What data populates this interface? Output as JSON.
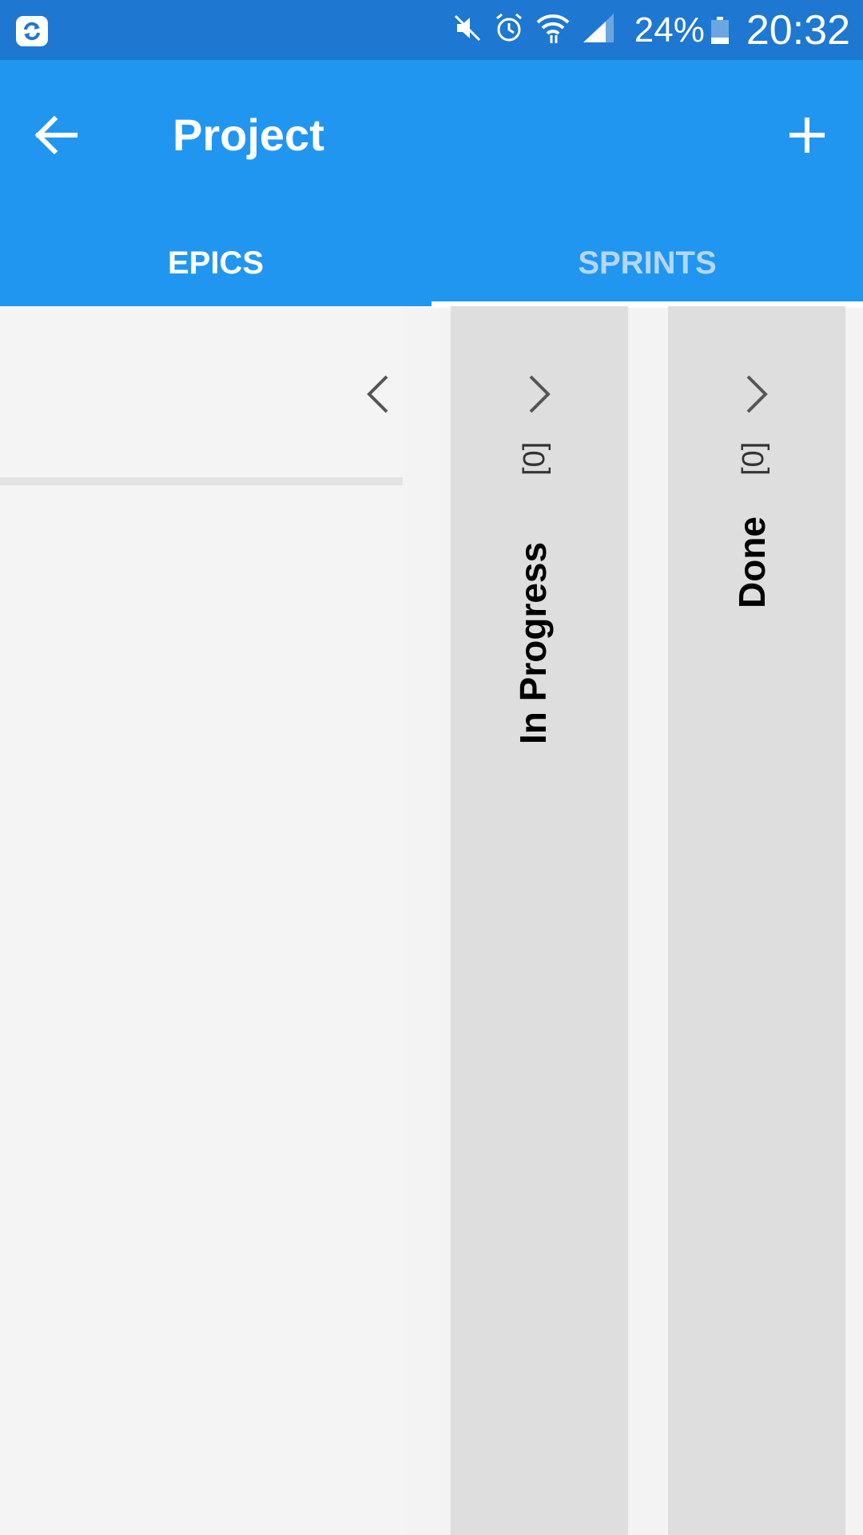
{
  "status_bar": {
    "battery_percent": "24%",
    "battery_level": 0.24,
    "time": "20:32",
    "icons": [
      "sync-app-icon",
      "mute-icon",
      "alarm-icon",
      "wifi-icon",
      "signal-icon",
      "battery-icon"
    ]
  },
  "app_bar": {
    "title": "Project",
    "back_icon": "arrow-left-icon",
    "add_icon": "plus-icon",
    "background": "#2196f0"
  },
  "tabs": [
    {
      "label": "EPICS",
      "selected": false
    },
    {
      "label": "SPRINTS",
      "selected": true
    }
  ],
  "board": {
    "columns": [
      {
        "name": "",
        "count": "",
        "chevron": "chevron-left-icon"
      },
      {
        "name": "In Progress",
        "count": "[0]",
        "chevron": "chevron-right-icon"
      },
      {
        "name": "Done",
        "count": "[0]",
        "chevron": "chevron-right-icon"
      }
    ]
  }
}
